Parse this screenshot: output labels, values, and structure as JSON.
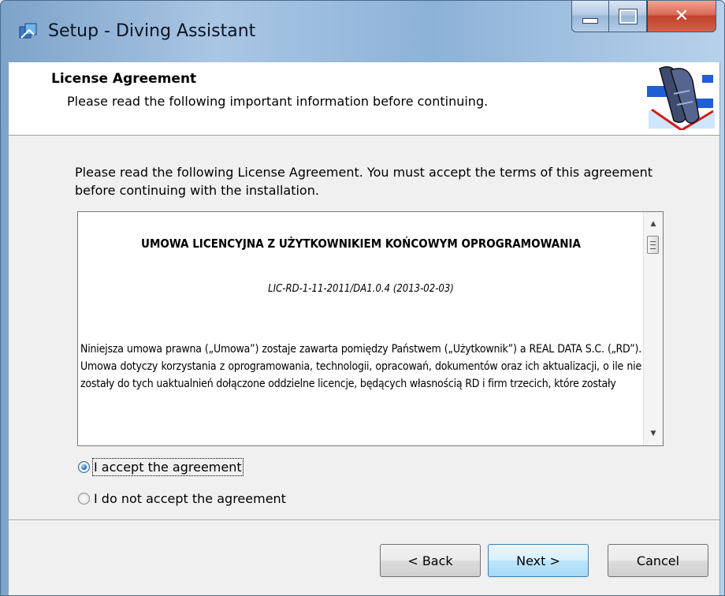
{
  "window": {
    "title": "Setup - Diving Assistant",
    "icon": "setup-app-icon",
    "caption_buttons": [
      "minimize",
      "maximize",
      "close"
    ]
  },
  "header": {
    "title": "License Agreement",
    "subtitle": "Please read the following important information before continuing.",
    "image": "diving-fins-image"
  },
  "intro_text": "Please read the following License Agreement. You must accept the terms of this agreement before continuing with the installation.",
  "license": {
    "title": "UMOWA LICENCYJNA Z UŻYTKOWNIKIEM KOŃCOWYM OPROGRAMOWANIA",
    "code": "LIC-RD-1-11-2011/DA1.0.4 (2013-02-03)",
    "body": "Niniejsza umowa prawna („Umowa”) zostaje zawarta pomiędzy Państwem („Użytkownik”) a REAL DATA S.C. („RD”). Umowa dotyczy korzystania z oprogramowania, technologii, opracowań, dokumentów oraz ich aktualizacji, o ile nie zostały do tych uaktualnień dołączone oddzielne licencje, będących własnością RD i firm trzecich, które zostały"
  },
  "options": {
    "accept_label": "I accept the agreement",
    "accept_mnemonic": "a",
    "decline_label": "I do not accept the agreement",
    "decline_mnemonic": "d",
    "selected": "accept"
  },
  "buttons": {
    "back": "< Back",
    "next": "Next >",
    "cancel": "Cancel"
  },
  "colors": {
    "title_bar": "#a9c6e4",
    "close_button": "#c0412b",
    "dialog_bg": "#f0f0f0",
    "default_button_border": "#3c7fb1"
  }
}
